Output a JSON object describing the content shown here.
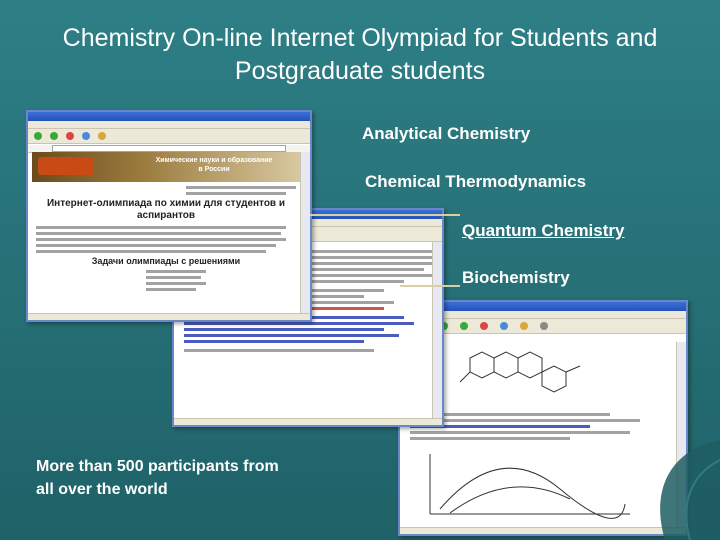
{
  "slide": {
    "title": "Chemistry On-line Internet Olympiad for Students and Postgraduate students",
    "topics": [
      "Analytical Chemistry",
      "Chemical Thermodynamics",
      "Quantum Chemistry",
      "Biochemistry"
    ],
    "footnote": "More than 500 participants from all over the world"
  },
  "window1": {
    "site_heading": "Химические науки и образование в России",
    "page_heading": "Интернет-олимпиада по химии для студентов и аспирантов",
    "section_heading": "Задачи олимпиады с решениями"
  },
  "colors": {
    "background": "#277278",
    "text": "#ffffff",
    "window_frame": "#6a88c8"
  }
}
